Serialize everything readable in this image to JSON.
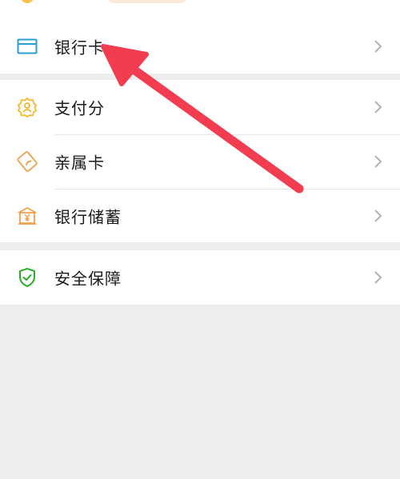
{
  "menu": {
    "bank_card": "银行卡",
    "payment_score": "支付分",
    "family_card": "亲属卡",
    "bank_savings": "银行储蓄",
    "security": "安全保障"
  },
  "icons": {
    "bank_card": "bank-card-icon",
    "payment_score": "payment-score-icon",
    "family_card": "family-card-icon",
    "bank_savings": "bank-savings-icon",
    "security": "shield-check-icon",
    "chevron": "chevron-right-icon"
  },
  "colors": {
    "bank_card_icon": "#2a9fd6",
    "payment_score_icon": "#f2b92c",
    "family_card_icon": "#f0a04b",
    "bank_savings_icon": "#f0a04b",
    "security_icon": "#1aad19",
    "arrow": "#f23c50"
  }
}
